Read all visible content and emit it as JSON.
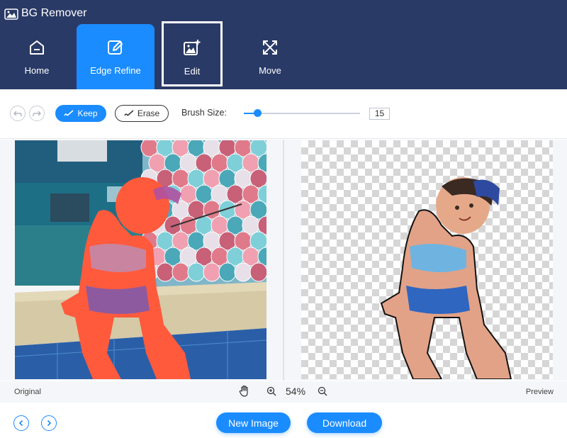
{
  "app": {
    "title": "BG Remover",
    "logo_icon": "cloud-image-icon"
  },
  "nav": {
    "tabs": [
      {
        "label": "Home",
        "icon": "home-icon",
        "active": false
      },
      {
        "label": "Edge Refine",
        "icon": "edit-pen-icon",
        "active": true
      },
      {
        "label": "Edit",
        "icon": "image-edit-icon",
        "active": false,
        "highlighted": true
      },
      {
        "label": "Move",
        "icon": "move-arrows-icon",
        "active": false
      }
    ]
  },
  "toolbar": {
    "undo_icon": "undo-icon",
    "redo_icon": "redo-icon",
    "keep_label": "Keep",
    "erase_label": "Erase",
    "brush_size_label": "Brush Size:",
    "brush_size_value": "15",
    "brush_slider_fraction": 0.12
  },
  "workspace": {
    "original_label": "Original",
    "preview_label": "Preview",
    "zoom_level": "54%"
  },
  "actions": {
    "new_image_label": "New Image",
    "download_label": "Download"
  },
  "colors": {
    "header_bg": "#2a3a66",
    "accent": "#1a8cff",
    "keep_overlay": "#ff5a3c"
  }
}
